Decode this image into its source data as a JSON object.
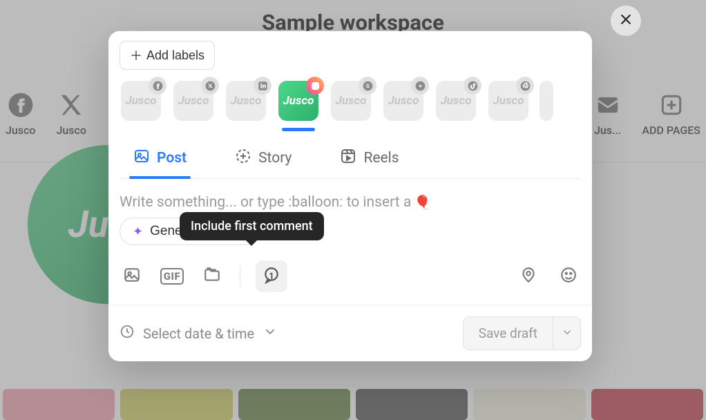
{
  "header": {
    "title": "Sample workspace"
  },
  "bg_tabs": [
    {
      "label": "Jusco",
      "icon": "facebook"
    },
    {
      "label": "Jusco",
      "icon": "x"
    },
    {
      "label": "Jus...",
      "icon": "mail"
    },
    {
      "label": "ADD PAGES",
      "icon": "plus"
    }
  ],
  "bg_profile_text": "Jusc",
  "modal": {
    "add_labels": "Add labels",
    "accounts": [
      {
        "badge": "facebook",
        "active": false
      },
      {
        "badge": "x",
        "active": false
      },
      {
        "badge": "linkedin",
        "active": false
      },
      {
        "badge": "instagram",
        "active": true
      },
      {
        "badge": "google",
        "active": false
      },
      {
        "badge": "youtube",
        "active": false
      },
      {
        "badge": "tiktok",
        "active": false
      },
      {
        "badge": "pinterest",
        "active": false
      }
    ],
    "account_text": "Jusco",
    "account_text_active": "Jusco",
    "tabs": {
      "post": "Post",
      "story": "Story",
      "reels": "Reels"
    },
    "placeholder": "Write something... or type :balloon: to insert a",
    "balloon_emoji": "🎈",
    "ai_label": "Generate with AI",
    "tooltip": "Include first comment",
    "comment_badge": "1",
    "datetime_label": "Select date & time",
    "save_label": "Save draft"
  }
}
